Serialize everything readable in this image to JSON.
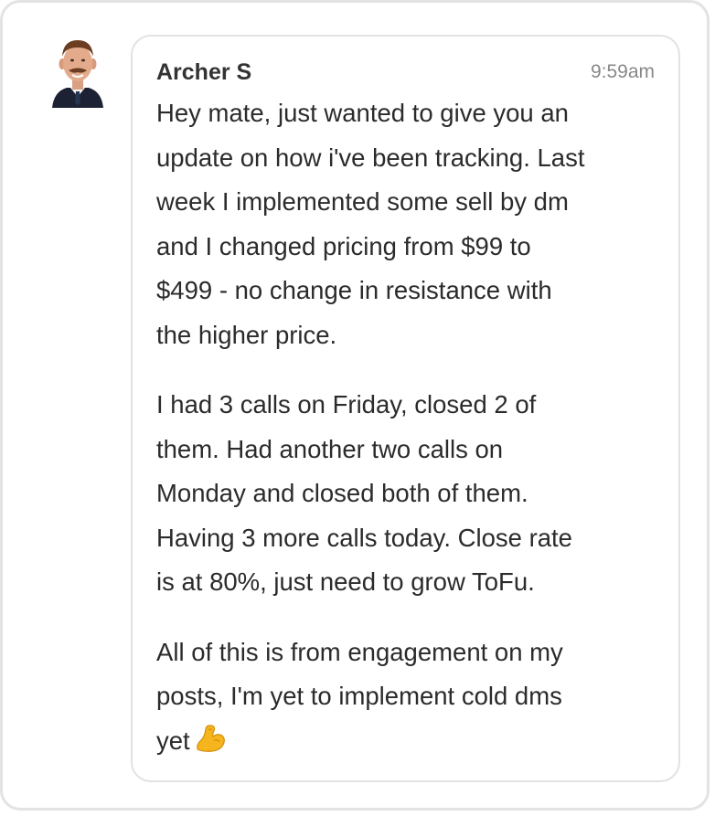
{
  "message": {
    "sender": "Archer S",
    "time": "9:59am",
    "paragraphs": [
      "Hey mate, just wanted to give you an\nupdate on how i've been tracking. Last\nweek I implemented some sell by dm\nand I changed pricing from $99 to\n$499 - no change in resistance with\nthe higher price.",
      "I had 3 calls on Friday, closed 2 of\nthem. Had another two calls on\nMonday and closed both of them.\nHaving 3 more calls today. Close rate\nis at 80%, just need to grow ToFu.",
      "All of this is from engagement on my\nposts, I'm yet to implement cold dms\nyet"
    ],
    "trailing_emoji": "flexed-biceps-icon"
  },
  "colors": {
    "border": "#e2e2e2",
    "text": "#2b2b2b",
    "time": "#888888",
    "emoji": "#f5b51d"
  }
}
